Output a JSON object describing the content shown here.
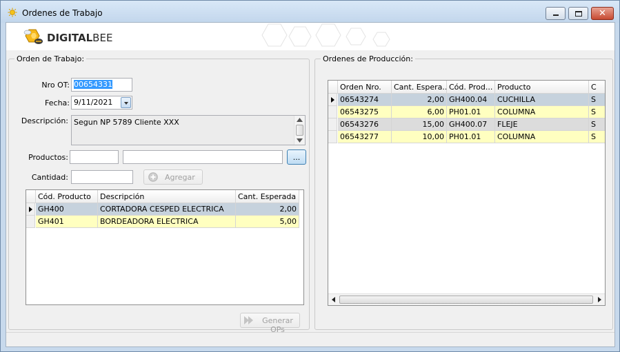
{
  "window": {
    "title": "Ordenes de Trabajo"
  },
  "brand": {
    "name_bold": "DIGITAL",
    "name_light": "BEE"
  },
  "orden_trabajo": {
    "legend": "Orden de Trabajo:",
    "nro_label": "Nro OT:",
    "nro_value": "00654331",
    "fecha_label": "Fecha:",
    "fecha_value": "9/11/2021",
    "descripcion_label": "Descripción:",
    "descripcion_value": "Segun NP 5789 Cliente XXX",
    "productos_label": "Productos:",
    "productos_code_value": "",
    "productos_name_value": "",
    "browse_label": "...",
    "cantidad_label": "Cantidad:",
    "cantidad_value": "",
    "agregar_label": "Agregar",
    "generar_label": "Generar OPs"
  },
  "items_grid": {
    "columns": [
      "Cód. Producto",
      "Descripción",
      "Cant. Esperada"
    ],
    "rows": [
      [
        "GH400",
        "CORTADORA CESPED ELECTRICA",
        "2,00"
      ],
      [
        "GH401",
        "BORDEADORA ELECTRICA",
        "5,00"
      ]
    ]
  },
  "ordenes_produccion": {
    "legend": "Ordenes de Producción:",
    "columns": [
      "Orden Nro.",
      "Cant. Espera...",
      "Cód. Prod...",
      "Producto",
      "C"
    ],
    "rows": [
      [
        "06543274",
        "2,00",
        "GH400.04",
        "CUCHILLA",
        "S"
      ],
      [
        "06543275",
        "6,00",
        "PH01.01",
        "COLUMNA",
        "S"
      ],
      [
        "06543276",
        "15,00",
        "GH400.07",
        "FLEJE",
        "S"
      ],
      [
        "06543277",
        "10,00",
        "PH01.01",
        "COLUMNA",
        "S"
      ]
    ]
  },
  "colors": {
    "selected_row": "#c6d2dd",
    "alt_row": "#ffffc0",
    "plain_row": "#dcdcdc",
    "text_selection": "#3399ff"
  }
}
